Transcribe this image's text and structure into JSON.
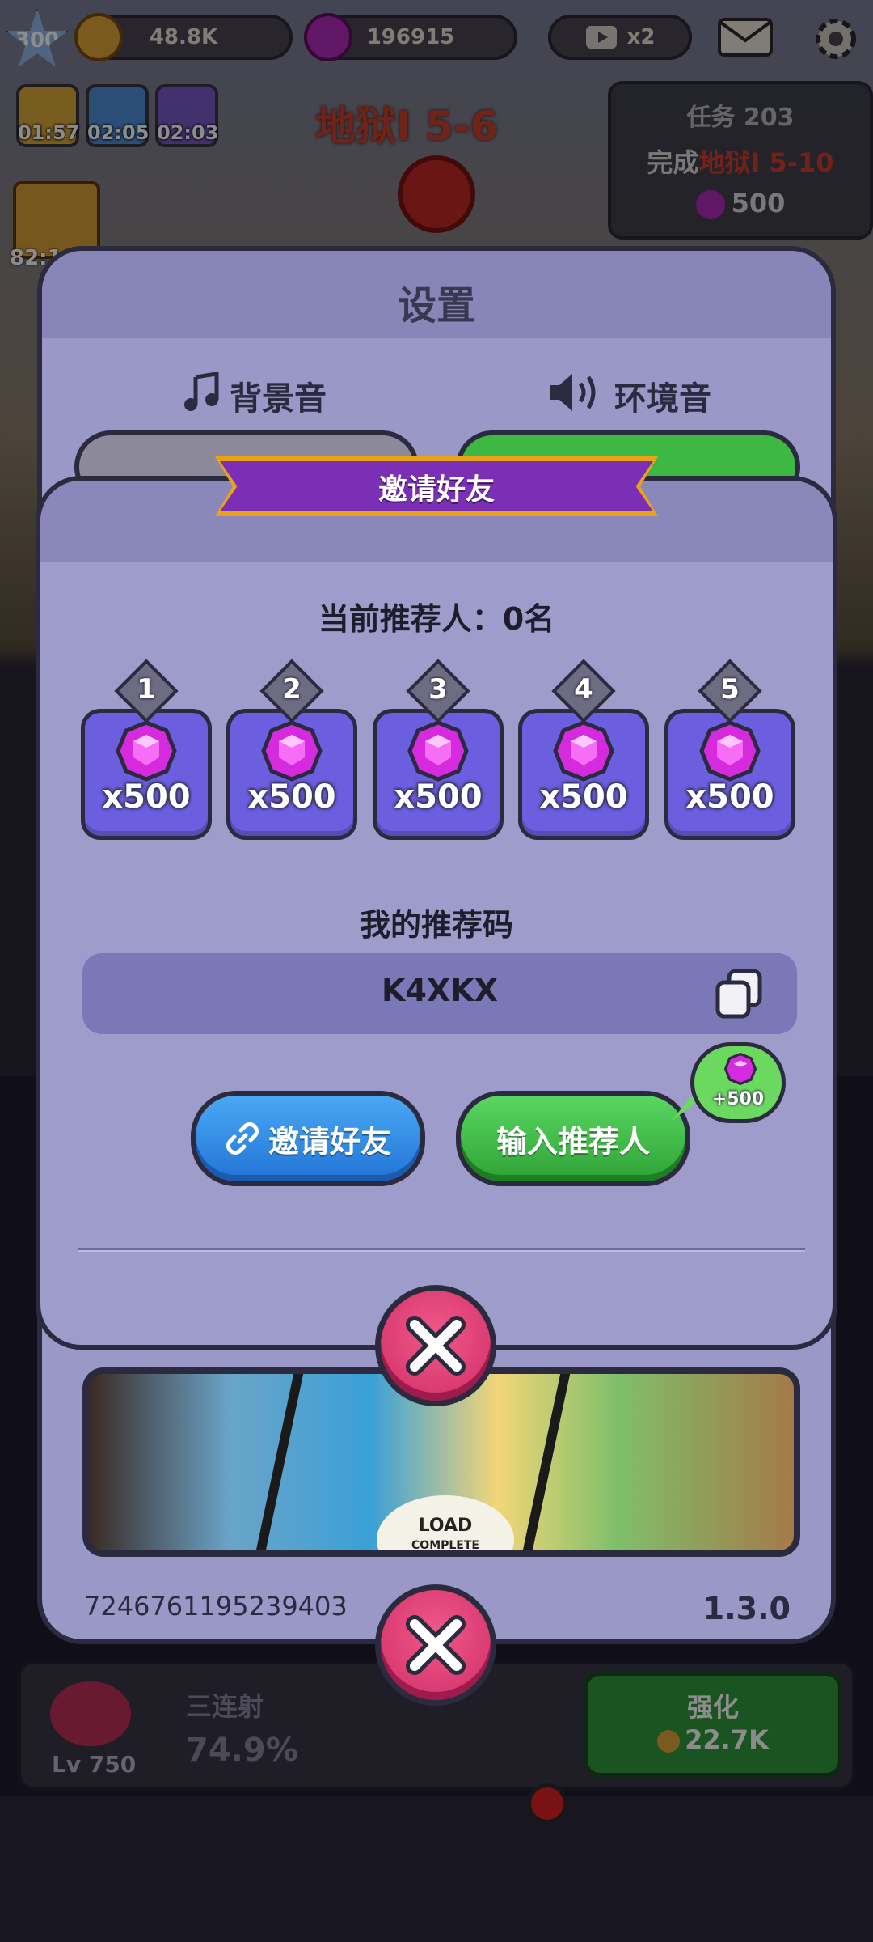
{
  "hud": {
    "player_level": "300",
    "gold": "48.8K",
    "gems": "196915",
    "video_multiplier": "x2",
    "buffs": [
      {
        "time": "01:57"
      },
      {
        "time": "02:05"
      },
      {
        "time": "02:03"
      }
    ],
    "side_timer": "82:1",
    "stage": "地狱I 5-6",
    "task": {
      "title": "任务 203",
      "desc_prefix": "完成",
      "desc_highlight": "地狱I 5-10",
      "reward": "500"
    }
  },
  "settings": {
    "title": "设置",
    "bgm_label": "背景音",
    "ambient_label": "环境音",
    "player_id": "7246761195239403",
    "version": "1.3.0"
  },
  "invite": {
    "title": "邀请好友",
    "referrer_count": "当前推荐人：0名",
    "rewards": [
      {
        "index": "1",
        "amount": "x500"
      },
      {
        "index": "2",
        "amount": "x500"
      },
      {
        "index": "3",
        "amount": "x500"
      },
      {
        "index": "4",
        "amount": "x500"
      },
      {
        "index": "5",
        "amount": "x500"
      }
    ],
    "code_title": "我的推荐码",
    "code": "K4XKX",
    "invite_button": "邀请好友",
    "enter_referrer_button": "输入推荐人",
    "bonus": "+500"
  },
  "ad": {
    "badge_line1": "LOAD",
    "badge_line2": "COMPLETE"
  },
  "skill": {
    "level": "Lv 750",
    "name": "三连射",
    "percent": "74.9%",
    "upgrade_label": "强化",
    "upgrade_cost": "22.7K"
  },
  "colors": {
    "panel": "#9e9cca",
    "outline": "#2c2a3e",
    "ribbon": "#7a2fb4",
    "ribbon_edge": "#e9a21a",
    "reward_card": "#6b5fe0",
    "gem": "#d62adf",
    "invite_btn": "#2f8be6",
    "enter_btn": "#3cb843",
    "close_btn": "#e0487a"
  },
  "icons": [
    "music-note-icon",
    "speaker-icon",
    "link-icon",
    "copy-icon",
    "gem-icon",
    "close-icon",
    "mail-icon",
    "gear-icon",
    "video-icon"
  ]
}
